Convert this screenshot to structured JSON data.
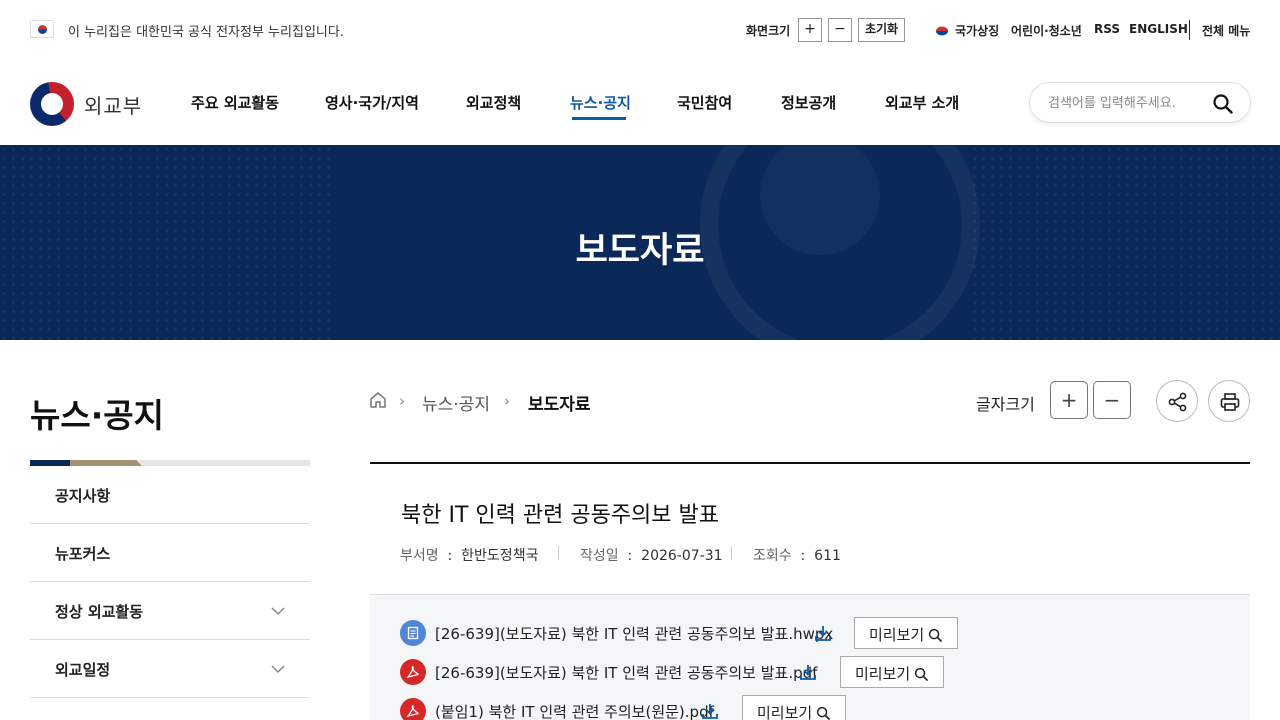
{
  "topbar": {
    "gov_notice": "이 누리집은 대한민국 공식 전자정부 누리집입니다.",
    "fontsize_label": "화면크기",
    "plus": "+",
    "minus": "−",
    "reset": "초기화",
    "national_symbol": "국가상징",
    "kids": "어린이·청소년",
    "rss": "RSS",
    "english": "ENGLISH",
    "all_menu": "전체 메뉴"
  },
  "logo": {
    "text": "외교부"
  },
  "gnb": {
    "items": [
      "주요 외교활동",
      "영사·국가/지역",
      "외교정책",
      "뉴스·공지",
      "국민참여",
      "정보공개",
      "외교부 소개"
    ],
    "active_index": 3
  },
  "search": {
    "placeholder": "검색어를 입력해주세요."
  },
  "hero": {
    "title": "보도자료"
  },
  "lnb": {
    "title": "뉴스·공지",
    "items": [
      {
        "label": "공지사항",
        "has_children": false
      },
      {
        "label": "뉴포커스",
        "has_children": false
      },
      {
        "label": "정상 외교활동",
        "has_children": true
      },
      {
        "label": "외교일정",
        "has_children": true
      }
    ]
  },
  "breadcrumb": {
    "items": [
      "뉴스·공지",
      "보도자료"
    ]
  },
  "tools": {
    "font_label": "글자크기",
    "plus": "+",
    "minus": "−"
  },
  "post": {
    "title": "북한 IT 인력 관련 공동주의보 발표",
    "dept_label": "부서명",
    "dept": "한반도정책국",
    "date_label": "작성일",
    "date": "2026-07-31",
    "views_label": "조회수",
    "views": "611"
  },
  "attachments": [
    {
      "type": "hwp",
      "name": "[26-639](보도자료) 북한 IT 인력 관련 공동주의보 발표.hwpx",
      "preview": "미리보기"
    },
    {
      "type": "pdf",
      "name": "[26-639](보도자료) 북한 IT 인력 관련 공동주의보 발표.pdf",
      "preview": "미리보기"
    },
    {
      "type": "pdf",
      "name": "(붙임1) 북한 IT 인력 관련 주의보(원문).pdf",
      "preview": "미리보기"
    }
  ],
  "colors": {
    "navy": "#0a2958",
    "accent_blue": "#0b5aa8",
    "pdf_red": "#d62828",
    "hwp_blue": "#4f86d6",
    "gold": "#a49073"
  }
}
